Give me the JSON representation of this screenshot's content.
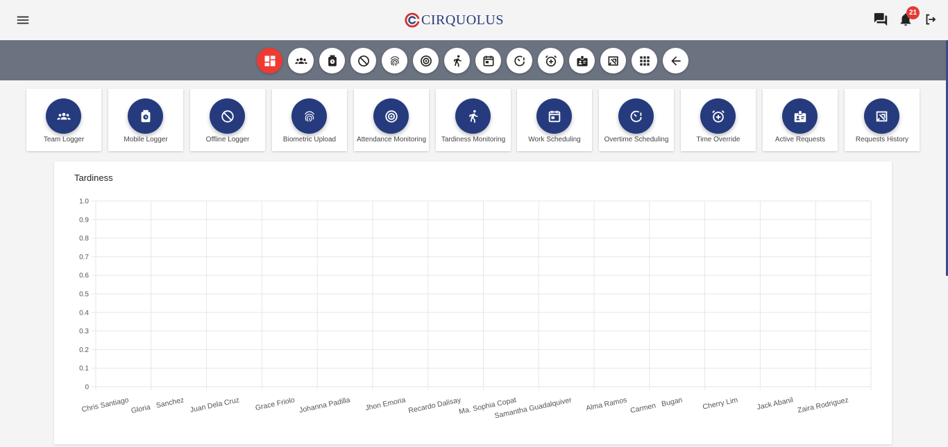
{
  "header": {
    "logo_text": "CIRQUOLUS",
    "notification_count": "21",
    "brand_color": "#2b3b7a",
    "accent_color": "#e53935",
    "icons": [
      "menu-icon",
      "chat-icon",
      "bell-icon",
      "logout-icon"
    ]
  },
  "toolbar": {
    "buttons": [
      {
        "icon": "dashboard-icon",
        "active": true
      },
      {
        "icon": "team-icon"
      },
      {
        "icon": "mobile-logger-icon"
      },
      {
        "icon": "offline-icon"
      },
      {
        "icon": "fingerprint-icon"
      },
      {
        "icon": "target-icon"
      },
      {
        "icon": "running-icon"
      },
      {
        "icon": "calendar-icon"
      },
      {
        "icon": "overtime-icon"
      },
      {
        "icon": "alarm-add-icon"
      },
      {
        "icon": "badge-icon"
      },
      {
        "icon": "history-icon"
      },
      {
        "icon": "apps-grid-icon"
      },
      {
        "icon": "back-arrow-icon"
      }
    ]
  },
  "cards": [
    {
      "label": "Team Logger",
      "icon": "team-icon"
    },
    {
      "label": "Mobile Logger",
      "icon": "mobile-logger-icon"
    },
    {
      "label": "Offline Logger",
      "icon": "offline-icon"
    },
    {
      "label": "Biometric Upload",
      "icon": "fingerprint-icon"
    },
    {
      "label": "Attendance Monitoring",
      "icon": "target-icon"
    },
    {
      "label": "Tardiness Monitoring",
      "icon": "running-icon"
    },
    {
      "label": "Work Scheduling",
      "icon": "calendar-icon"
    },
    {
      "label": "Overtime Scheduling",
      "icon": "overtime-icon"
    },
    {
      "label": "Time Override",
      "icon": "alarm-add-icon"
    },
    {
      "label": "Active Requests",
      "icon": "badge-icon"
    },
    {
      "label": "Requests History",
      "icon": "history-icon"
    }
  ],
  "chart_data": {
    "type": "bar",
    "title": "Tardiness",
    "categories": [
      "Chris Santiago",
      "Gloria   Sanchez",
      "Juan Dela Cruz",
      "Grace Friolo",
      "Johanna Padilla",
      "Jhon Emoria",
      "Recardo Dalisay",
      "Ma. Sophia Copat",
      "Samantha Guadalquiver",
      "Alma Ramos",
      "Carmen   Bugan",
      "Cherry Lim",
      "Jack Abanil",
      "Zaira Rodriguez"
    ],
    "values": [
      0,
      0,
      0,
      0,
      0,
      0,
      0,
      0,
      0,
      0,
      0,
      0,
      0,
      0
    ],
    "yticks": [
      "0",
      "0.1",
      "0.2",
      "0.3",
      "0.4",
      "0.5",
      "0.6",
      "0.7",
      "0.8",
      "0.9",
      "1.0"
    ],
    "ylim": [
      0,
      1
    ],
    "grid": true,
    "xlabel": "",
    "ylabel": ""
  }
}
